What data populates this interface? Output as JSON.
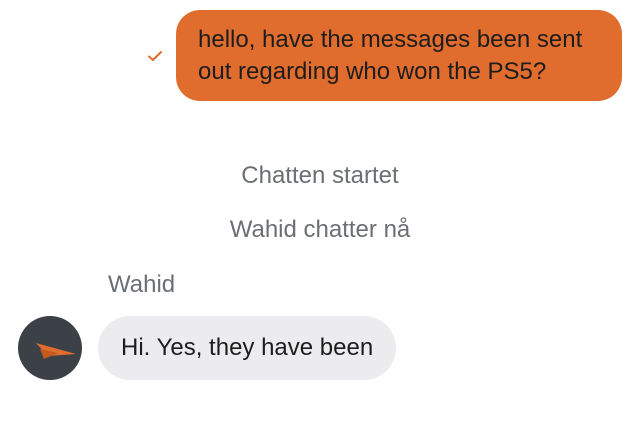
{
  "colors": {
    "outgoing_bubble": "#e06d2e",
    "incoming_bubble": "#ececee",
    "system_text": "#6b6f74",
    "avatar_bg": "#3c4047",
    "accent": "#e06d2e"
  },
  "messages": {
    "outgoing": {
      "text": "hello, have the messages been sent out regarding who won the PS5?",
      "status_icon": "checkmark-icon"
    },
    "system": [
      "Chatten startet",
      "Wahid chatter nå"
    ],
    "incoming": {
      "sender": "Wahid",
      "text": "Hi. Yes, they have been",
      "avatar_icon": "agent-logo-icon"
    }
  }
}
